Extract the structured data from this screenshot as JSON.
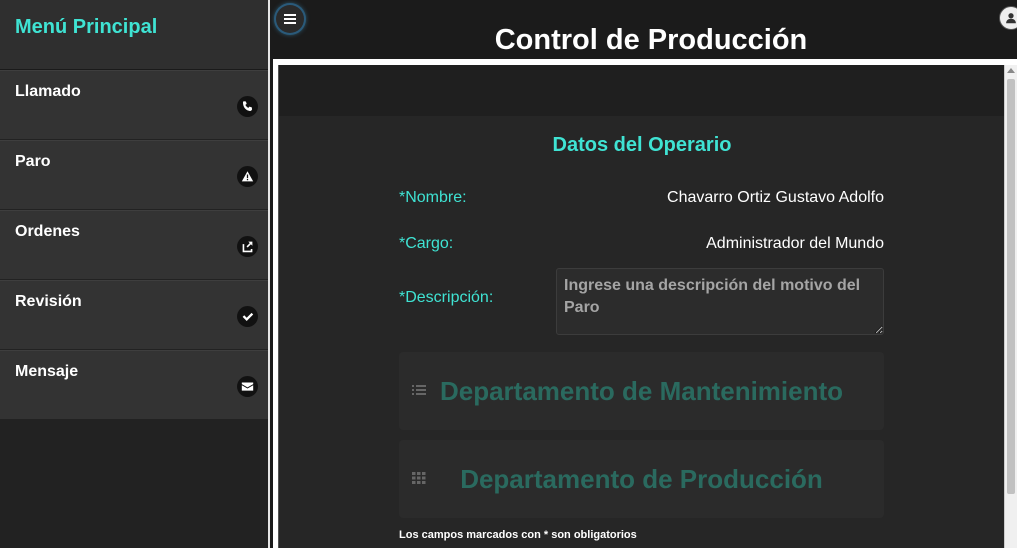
{
  "sidebar": {
    "title": "Menú Principal",
    "items": [
      {
        "label": "Llamado",
        "icon": "phone-icon"
      },
      {
        "label": "Paro",
        "icon": "warning-icon"
      },
      {
        "label": "Ordenes",
        "icon": "share-icon"
      },
      {
        "label": "Revisión",
        "icon": "check-icon"
      },
      {
        "label": "Mensaje",
        "icon": "mail-icon"
      }
    ]
  },
  "header": {
    "title": "Control de Producción"
  },
  "form": {
    "title": "Datos del Operario",
    "nombre_label": "*Nombre:",
    "nombre_value": "Chavarro Ortiz Gustavo Adolfo",
    "cargo_label": "*Cargo:",
    "cargo_value": "Administrador del Mundo",
    "descripcion_label": "*Descripción:",
    "descripcion_placeholder": "Ingrese una descripción del motivo del Paro",
    "dept_mantenimiento": "Departamento de Mantenimiento",
    "dept_produccion": "Departamento de Producción",
    "required_note": "Los campos marcados con * son obligatorios"
  },
  "colors": {
    "accent": "#3fe3d3",
    "dept_text": "#2a6a5f",
    "background": "#262626"
  }
}
